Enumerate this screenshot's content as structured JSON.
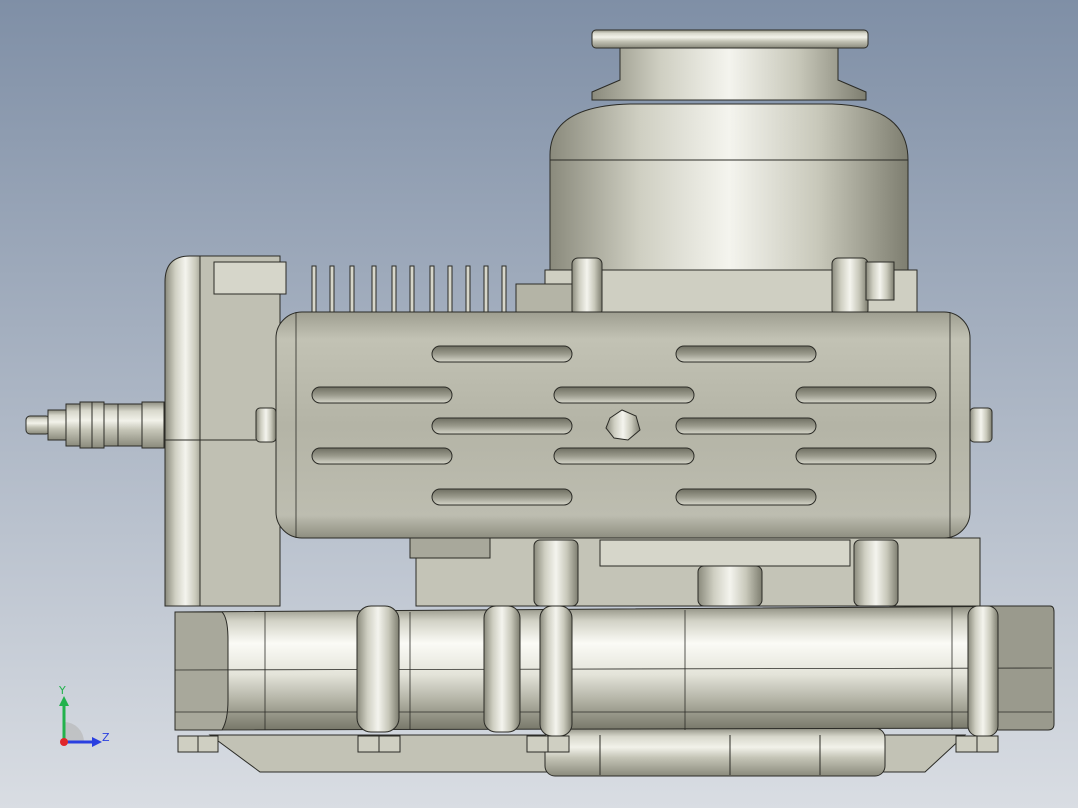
{
  "viewport": {
    "background_top": "#7f8fa6",
    "background_bottom": "#d9dde3"
  },
  "model": {
    "body_color": "#c9c9bc",
    "body_shade": "#9c9c8e",
    "edge_color": "#2b2b26",
    "highlight": "#f4f4ee"
  },
  "triad": {
    "y_label": "Y",
    "z_label": "Z",
    "y_color": "#22b24c",
    "z_color": "#2a3fe0",
    "x_color": "#e0262a"
  }
}
